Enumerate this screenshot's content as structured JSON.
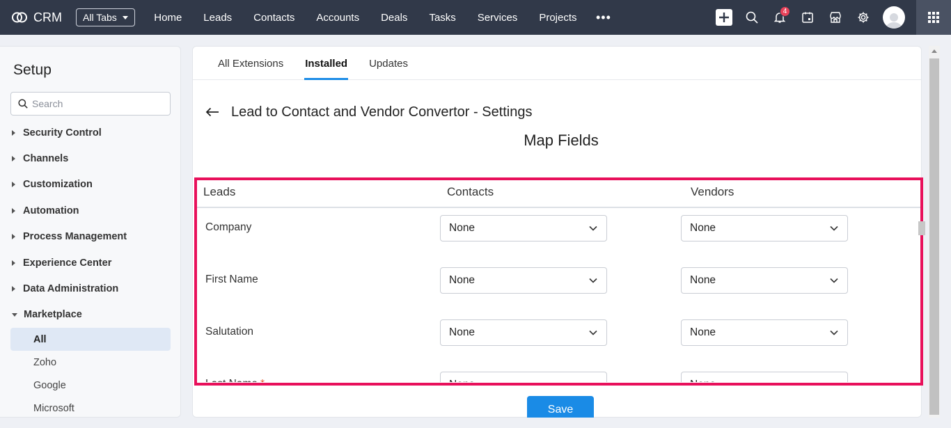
{
  "topbar": {
    "brand": "CRM",
    "all_tabs_label": "All Tabs",
    "nav": [
      "Home",
      "Leads",
      "Contacts",
      "Accounts",
      "Deals",
      "Tasks",
      "Services",
      "Projects"
    ],
    "notification_count": "4"
  },
  "sidebar": {
    "title": "Setup",
    "search_placeholder": "Search",
    "items": [
      "Security Control",
      "Channels",
      "Customization",
      "Automation",
      "Process Management",
      "Experience Center",
      "Data Administration"
    ],
    "expanded_item": "Marketplace",
    "sub_items": [
      "All",
      "Zoho",
      "Google",
      "Microsoft"
    ],
    "active_sub_item": "All"
  },
  "tabs": [
    "All Extensions",
    "Installed",
    "Updates"
  ],
  "active_tab": "Installed",
  "settings": {
    "title": "Lead to Contact and Vendor Convertor - Settings",
    "section_title": "Map Fields",
    "columns": [
      "Leads",
      "Contacts",
      "Vendors"
    ],
    "rows": [
      {
        "field": "Company",
        "contacts": "None",
        "vendors": "None",
        "required": false
      },
      {
        "field": "First Name",
        "contacts": "None",
        "vendors": "None",
        "required": false
      },
      {
        "field": "Salutation",
        "contacts": "None",
        "vendors": "None",
        "required": false
      },
      {
        "field": "Last Name",
        "contacts": "None",
        "vendors": "None",
        "required": true,
        "required_mark": "*"
      }
    ],
    "save_label": "Save"
  },
  "colors": {
    "topbar_bg": "#313949",
    "accent": "#1a8be6",
    "highlight_border": "#e8105b",
    "badge": "#e8425a"
  }
}
